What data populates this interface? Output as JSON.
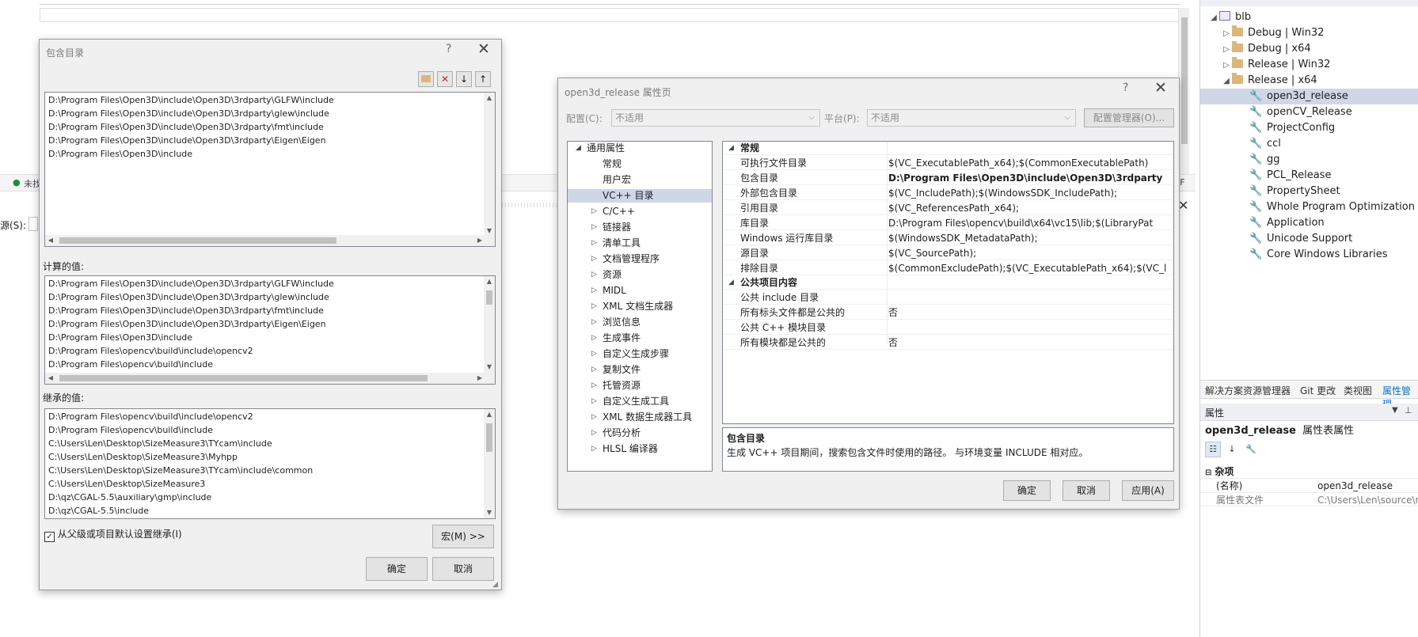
{
  "solution": {
    "root": "blb",
    "folders": [
      "Debug | Win32",
      "Debug | x64",
      "Release | Win32",
      "Release | x64"
    ],
    "sheets": [
      "open3d_release",
      "openCV_Release",
      "ProjectConfig",
      "ccl",
      "gg",
      "PCL_Release",
      "PropertySheet",
      "Whole Program Optimization",
      "Application",
      "Unicode Support",
      "Core Windows Libraries"
    ],
    "tabs": [
      "解决方案资源管理器",
      "Git 更改",
      "类视图",
      "属性管理"
    ],
    "properties": {
      "header": "属性",
      "object_name": "open3d_release",
      "object_type": "属性表属性",
      "category": "杂项",
      "rows": [
        {
          "k": "(名称)",
          "v": "open3d_release"
        },
        {
          "k": "属性表文件",
          "v": "C:\\Users\\Len\\source\\r"
        }
      ]
    }
  },
  "bg": {
    "status_text": "未找",
    "source_label": "源(S):",
    "lf": "LF"
  },
  "include_dialog": {
    "title": "包含目录",
    "help": "?",
    "close": "✕",
    "entries": [
      "D:\\Program Files\\Open3D\\include\\Open3D\\3rdparty\\GLFW\\include",
      "D:\\Program Files\\Open3D\\include\\Open3D\\3rdparty\\glew\\include",
      "D:\\Program Files\\Open3D\\include\\Open3D\\3rdparty\\fmt\\include",
      "D:\\Program Files\\Open3D\\include\\Open3D\\3rdparty\\Eigen\\Eigen",
      "D:\\Program Files\\Open3D\\include"
    ],
    "computed_label": "计算的值:",
    "computed": [
      "D:\\Program Files\\Open3D\\include\\Open3D\\3rdparty\\GLFW\\include",
      "D:\\Program Files\\Open3D\\include\\Open3D\\3rdparty\\glew\\include",
      "D:\\Program Files\\Open3D\\include\\Open3D\\3rdparty\\fmt\\include",
      "D:\\Program Files\\Open3D\\include\\Open3D\\3rdparty\\Eigen\\Eigen",
      "D:\\Program Files\\Open3D\\include",
      "D:\\Program Files\\opencv\\build\\include\\opencv2",
      "D:\\Program Files\\opencv\\build\\include"
    ],
    "inherited_label": "继承的值:",
    "inherited": [
      "D:\\Program Files\\opencv\\build\\include\\opencv2",
      "D:\\Program Files\\opencv\\build\\include",
      "C:\\Users\\Len\\Desktop\\SizeMeasure3\\TYcam\\include",
      "C:\\Users\\Len\\Desktop\\SizeMeasure3\\Myhpp",
      "C:\\Users\\Len\\Desktop\\SizeMeasure3\\TYcam\\include\\common",
      "C:\\Users\\Len\\Desktop\\SizeMeasure3",
      "D:\\qz\\CGAL-5.5\\auxiliary\\gmp\\include",
      "D:\\qz\\CGAL-5.5\\include"
    ],
    "inherit_checkbox": "从父级或项目默认设置继承(I)",
    "macro_button": "宏(M) >>",
    "ok": "确定",
    "cancel": "取消"
  },
  "prop_dialog": {
    "title": "open3d_release 属性页",
    "help": "?",
    "close": "✕",
    "config_label": "配置(C):",
    "config_value": "不适用",
    "platform_label": "平台(P):",
    "platform_value": "不适用",
    "config_manager": "配置管理器(O)...",
    "tree_root": "通用属性",
    "tree_leaves": [
      "常规",
      "用户宏",
      "VC++ 目录"
    ],
    "tree_expandable": [
      "C/C++",
      "链接器",
      "清单工具",
      "文档管理程序",
      "资源",
      "MIDL",
      "XML 文档生成器",
      "浏览信息",
      "生成事件",
      "自定义生成步骤",
      "复制文件",
      "托管资源",
      "自定义生成工具",
      "XML 数据生成器工具",
      "代码分析",
      "HLSL 编译器"
    ],
    "section_general": "常规",
    "rows_general": [
      {
        "k": "可执行文件目录",
        "v": "$(VC_ExecutablePath_x64);$(CommonExecutablePath)"
      },
      {
        "k": "包含目录",
        "v": "D:\\Program Files\\Open3D\\include\\Open3D\\3rdparty"
      },
      {
        "k": "外部包含目录",
        "v": "$(VC_IncludePath);$(WindowsSDK_IncludePath);"
      },
      {
        "k": "引用目录",
        "v": "$(VC_ReferencesPath_x64);"
      },
      {
        "k": "库目录",
        "v": "D:\\Program Files\\opencv\\build\\x64\\vc15\\lib;$(LibraryPat"
      },
      {
        "k": "Windows 运行库目录",
        "v": "$(WindowsSDK_MetadataPath);"
      },
      {
        "k": "源目录",
        "v": "$(VC_SourcePath);"
      },
      {
        "k": "排除目录",
        "v": "$(CommonExcludePath);$(VC_ExecutablePath_x64);$(VC_l"
      }
    ],
    "section_public": "公共项目内容",
    "rows_public": [
      {
        "k": "公共 include 目录",
        "v": ""
      },
      {
        "k": "所有标头文件都是公共的",
        "v": "否"
      },
      {
        "k": "公共 C++ 模块目录",
        "v": ""
      },
      {
        "k": "所有模块都是公共的",
        "v": "否"
      }
    ],
    "desc_title": "包含目录",
    "desc_text": "生成 VC++ 项目期间，搜索包含文件时使用的路径。 与环境变量 INCLUDE 相对应。",
    "ok": "确定",
    "cancel": "取消",
    "apply": "应用(A)"
  }
}
